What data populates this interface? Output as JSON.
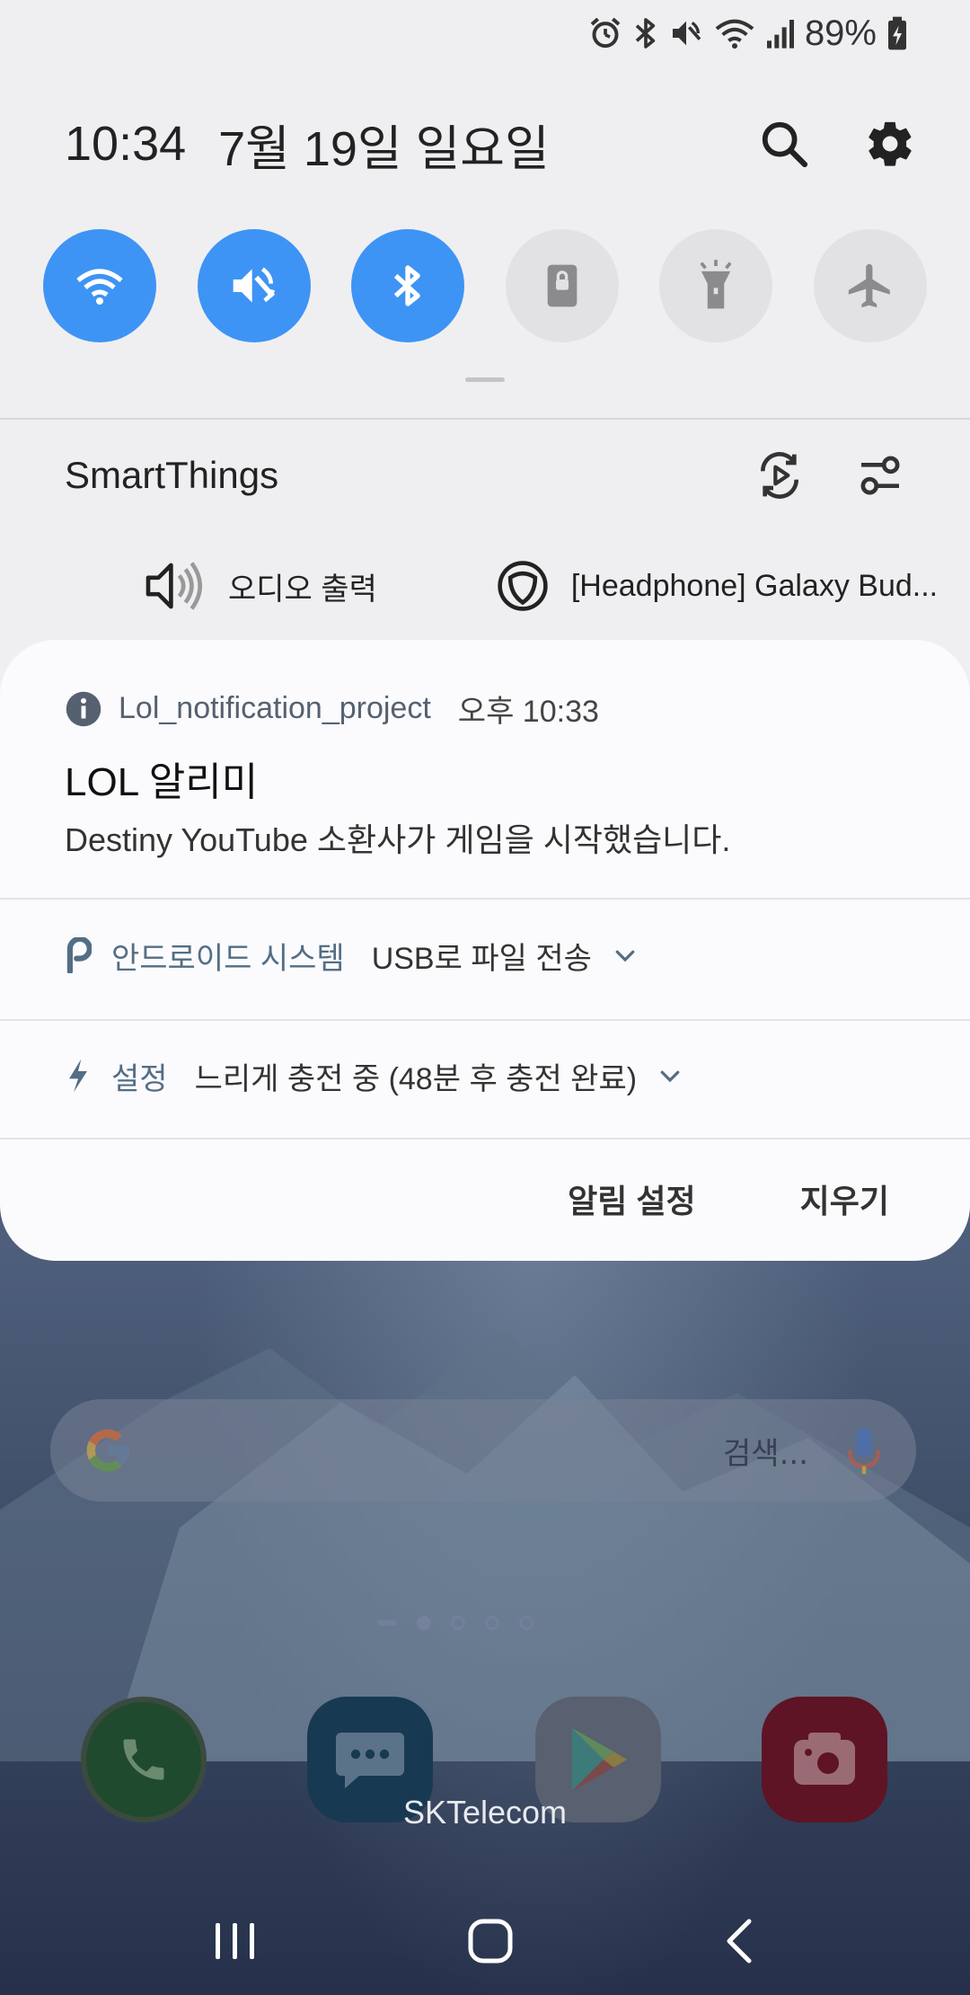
{
  "status_bar": {
    "battery": "89%",
    "icons": [
      "alarm-icon",
      "bluetooth-icon",
      "mute-icon",
      "wifi-icon",
      "signal-icon",
      "battery-charging-icon"
    ]
  },
  "header": {
    "time": "10:34",
    "date": "7월 19일 일요일",
    "icons": [
      "search-icon",
      "gear-icon"
    ]
  },
  "quick_settings": [
    {
      "name": "wifi",
      "state": "on"
    },
    {
      "name": "mute",
      "state": "on"
    },
    {
      "name": "bluetooth",
      "state": "on"
    },
    {
      "name": "lock",
      "state": "off"
    },
    {
      "name": "flashlight",
      "state": "off"
    },
    {
      "name": "airplane",
      "state": "off"
    }
  ],
  "smartthings": {
    "title": "SmartThings",
    "audio_output": "오디오 출력",
    "device": "[Headphone] Galaxy Bud..."
  },
  "notification": {
    "app": "Lol_notification_project",
    "time": "오후 10:33",
    "title": "LOL 알리미",
    "body": "Destiny YouTube 소환사가 게임을 시작했습니다."
  },
  "mini_notifications": [
    {
      "app": "안드로이드 시스템",
      "text": "USB로 파일 전송"
    },
    {
      "app": "설정",
      "text": "느리게 충전 중 (48분 후 충전 완료)"
    }
  ],
  "actions": {
    "settings": "알림 설정",
    "clear": "지우기"
  },
  "home": {
    "search_hint": "검색...",
    "carrier": "SKTelecom"
  },
  "colors": {
    "accent": "#3e94f4",
    "shade_bg": "#efeff1",
    "card_bg": "#fbfbfd"
  }
}
